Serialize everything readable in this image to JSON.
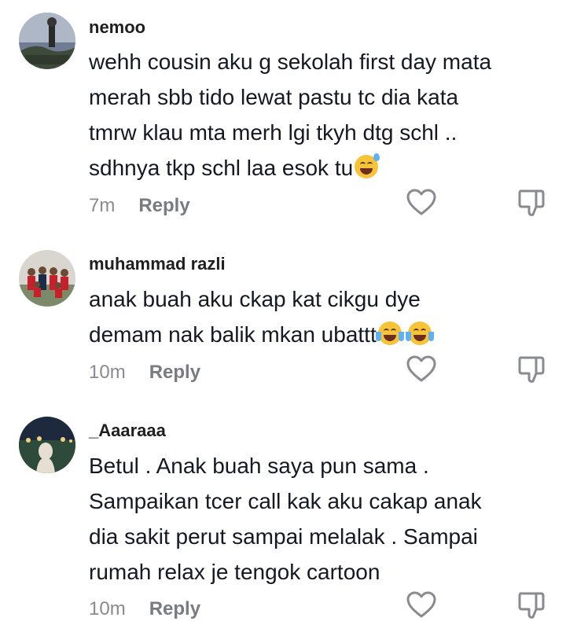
{
  "comments": [
    {
      "username": "nemoo",
      "lines": [
        "wehh cousin aku g sekolah first day mata",
        "merah sbb tido lewat pastu tc dia kata",
        "tmrw klau mta merh lgi tkyh dtg schl ..",
        "sdhnya tkp schl laa esok tu"
      ],
      "emoji_icon": "grinning-sweat-emoji",
      "time": "7m",
      "reply_label": "Reply"
    },
    {
      "username": "muhammad razli",
      "lines": [
        "anak buah aku ckap kat cikgu dye",
        "demam nak balik mkan ubattt"
      ],
      "emoji_icon": "tears-of-joy-emoji",
      "time": "10m",
      "reply_label": "Reply"
    },
    {
      "username": "_Aaaraaa",
      "lines": [
        "Betul . Anak buah saya pun sama .",
        "Sampaikan tcer call kak aku cakap anak",
        "dia sakit perut sampai melalak . Sampai",
        "rumah relax je tengok cartoon"
      ],
      "time": "10m",
      "reply_label": "Reply"
    }
  ],
  "icons": {
    "like": "heart-icon",
    "dislike": "thumbs-down-icon"
  }
}
